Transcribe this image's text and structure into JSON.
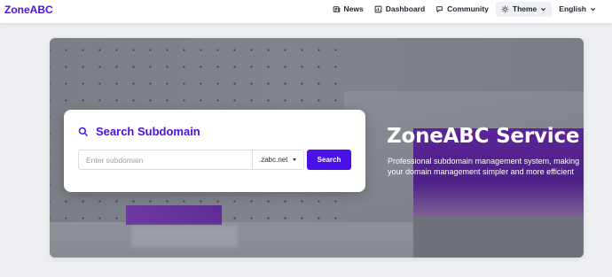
{
  "brand": {
    "logo_text": "ZoneABC",
    "accent": "#4a10e8"
  },
  "nav": {
    "items": [
      {
        "label": "News",
        "icon": "newspaper-icon"
      },
      {
        "label": "Dashboard",
        "icon": "dashboard-icon"
      },
      {
        "label": "Community",
        "icon": "chat-icon"
      }
    ],
    "theme_label": "Theme",
    "theme_icon": "sun-icon",
    "language": "English"
  },
  "hero": {
    "title": "ZoneABC Service",
    "subtitle": "Professional subdomain management system, making your domain management simpler and more efficient"
  },
  "search": {
    "title": "Search Subdomain",
    "placeholder": "Enter subdomain",
    "value": "",
    "domain_selected": ".zabc.net",
    "button_label": "Search"
  }
}
